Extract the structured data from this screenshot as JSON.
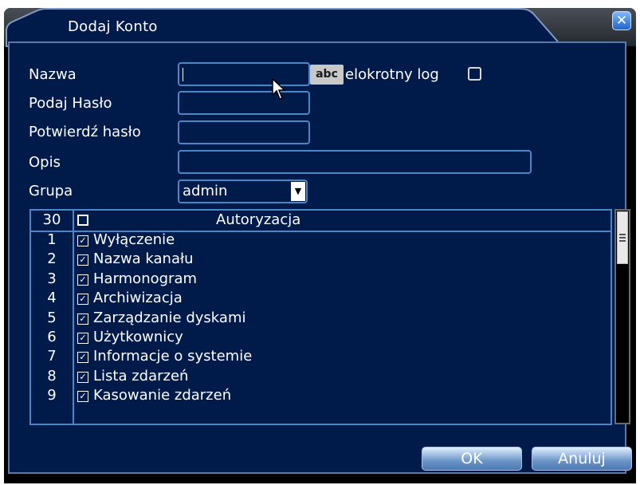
{
  "window": {
    "title": "Dodaj Konto",
    "close_glyph": "✕"
  },
  "form": {
    "name_label": "Nazwa",
    "name_value": "",
    "keyboard_button": "abc",
    "multi_login_label": "elokrotny log",
    "password_label": "Podaj Hasło",
    "confirm_label": "Potwierdź hasło",
    "description_label": "Opis",
    "group_label": "Grupa",
    "group_value": "admin"
  },
  "permissions": {
    "count": "30",
    "header": "Autoryzacja",
    "check_glyph": "✓",
    "rows": [
      {
        "num": "1",
        "label": "Wyłączenie",
        "checked": true
      },
      {
        "num": "2",
        "label": "Nazwa kanału",
        "checked": true
      },
      {
        "num": "3",
        "label": "Harmonogram",
        "checked": true
      },
      {
        "num": "4",
        "label": "Archiwizacja",
        "checked": true
      },
      {
        "num": "5",
        "label": "Zarządzanie dyskami",
        "checked": true
      },
      {
        "num": "6",
        "label": "Użytkownicy",
        "checked": true
      },
      {
        "num": "7",
        "label": "Informacje o systemie",
        "checked": true
      },
      {
        "num": "8",
        "label": "Lista zdarzeń",
        "checked": true
      },
      {
        "num": "9",
        "label": "Kasowanie zdarzeń",
        "checked": true
      }
    ]
  },
  "buttons": {
    "ok": "OK",
    "cancel": "Anuluj"
  },
  "icons": {
    "close": "close-icon",
    "dropdown": "chevron-down-icon",
    "cursor": "mouse-pointer-icon"
  }
}
